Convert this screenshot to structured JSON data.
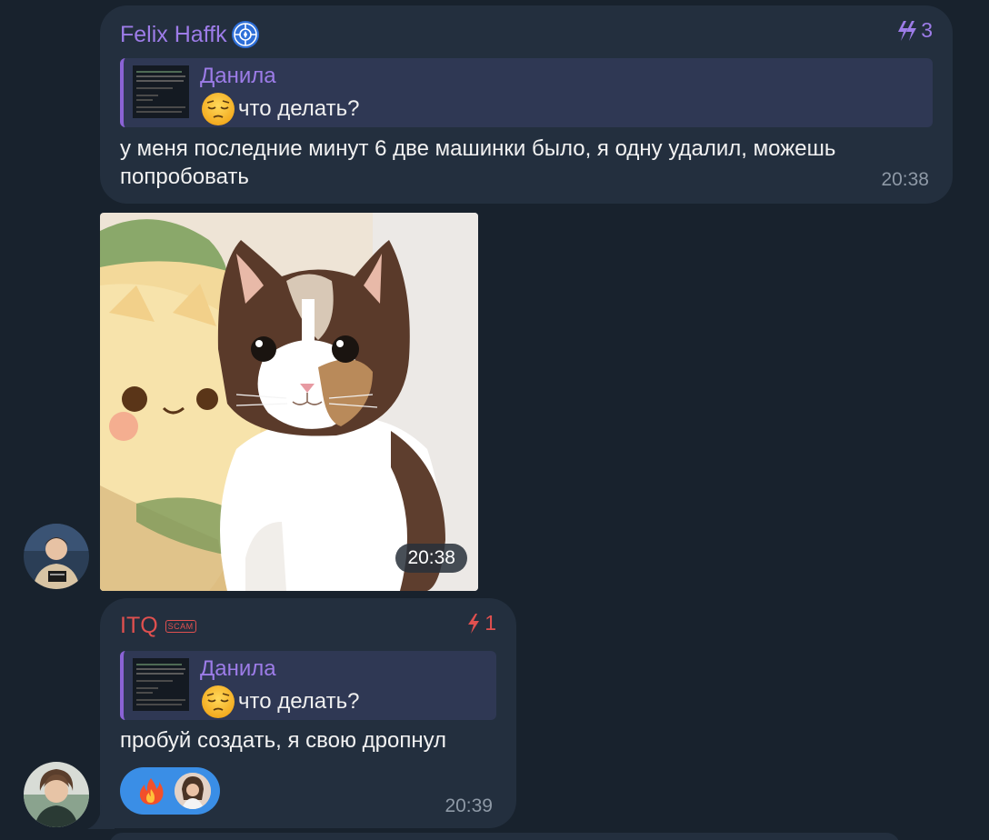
{
  "messages": [
    {
      "sender": "Felix Haffk",
      "sender_color": "#9d7ce8",
      "boost_count": "3",
      "reply_to": {
        "name": "Данила",
        "text": "что делать?"
      },
      "text": "у меня последние минут 6 две машинки было, я одну удалил, можешь попробовать",
      "time": "20:38"
    },
    {
      "type": "photo",
      "time": "20:38"
    },
    {
      "sender": "ITQ",
      "sender_color": "#e0504f",
      "badge": "SCAM",
      "boost_count": "1",
      "reply_to": {
        "name": "Данила",
        "text": "что делать?"
      },
      "text": "пробуй создать, я свою дропнул",
      "time": "20:39",
      "reaction": {
        "emoji": "fire-icon"
      }
    }
  ],
  "colors": {
    "background": "#18222d",
    "bubble": "#232f3e",
    "accent_purple": "#9d7ce8",
    "accent_red": "#e0504f",
    "reaction_blue": "#3a8ee6",
    "time_gray": "#8e99a6"
  }
}
